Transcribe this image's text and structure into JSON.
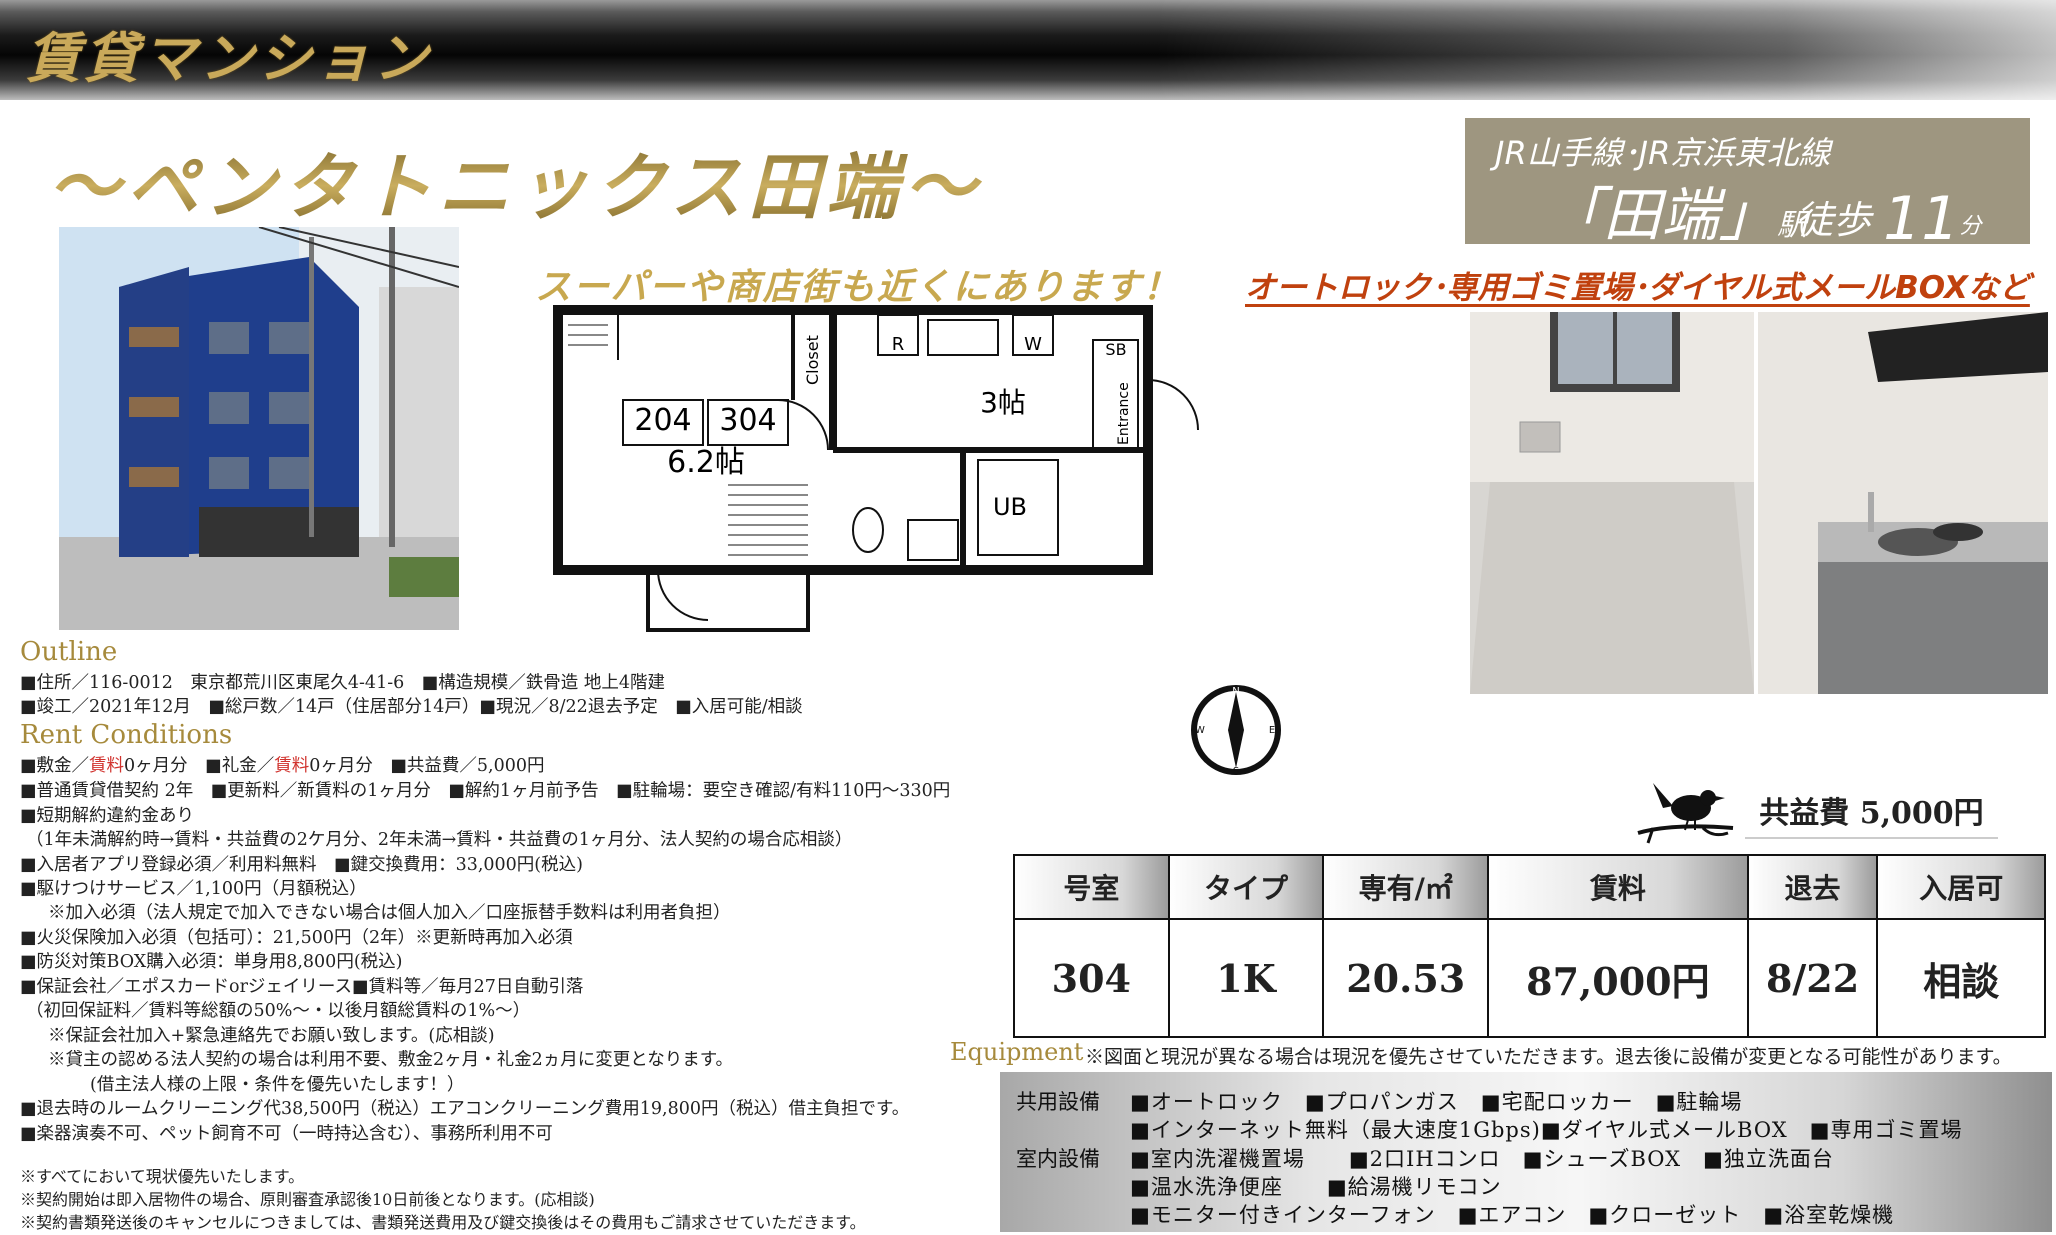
{
  "header": {
    "category": "賃貸マンション"
  },
  "property": {
    "name": "〜ペンタトニックス田端〜"
  },
  "station": {
    "lines": "JR山手線･JR京浜東北線",
    "name": "「田端」",
    "suffix": "駅",
    "walk_label": "徒歩",
    "walk_minutes": "11",
    "walk_unit": "分"
  },
  "features_highlight": "オートロック･専用ゴミ置場･ダイヤル式メールBOXなど",
  "floorplan": {
    "heading": "スーパーや商店街も近くにあります！",
    "room_numbers": [
      "204",
      "304"
    ],
    "main_room": "6.2帖",
    "kitchen": "3帖",
    "bath": "UB",
    "closet": "Closet",
    "entrance": "Entrance",
    "sb": "SB",
    "refrigerator": "R",
    "washer": "W"
  },
  "outline": {
    "label": "Outline",
    "lines": [
      "■住所／116-0012　東京都荒川区東尾久4-41-6　■構造規模／鉄骨造 地上4階建",
      "■竣工／2021年12月　■総戸数／14戸（住居部分14戸）■現況／8/22退去予定　■入居可能/相談"
    ]
  },
  "rent_conditions": {
    "label": "Rent Conditions",
    "deposit_prefix": "■敷金／",
    "deposit_red": "賃料",
    "deposit_suffix": "0ヶ月分　■礼金／",
    "key_red": "賃料",
    "key_suffix": "0ヶ月分　■共益費／5,000円",
    "lines": [
      "■普通賃貸借契約 2年　■更新料／新賃料の1ヶ月分　■解約1ヶ月前予告　■駐輪場：要空き確認/有料110円〜330円",
      "■短期解約違約金あり",
      "（1年未満解約時→賃料・共益費の2ケ月分、2年未満→賃料・共益費の1ヶ月分、法人契約の場合応相談）",
      "■入居者アプリ登録必須／利用料無料　■鍵交換費用：33,000円(税込)",
      "■駆けつけサービス／1,100円（月額税込）",
      "※加入必須（法人規定で加入できない場合は個人加入／口座振替手数料は利用者負担）",
      "■火災保険加入必須（包括可）：21,500円（2年）※更新時再加入必須",
      "■防災対策BOX購入必須：単身用8,800円(税込)",
      "■保証会社／エポスカードorジェイリース■賃料等／毎月27日自動引落",
      "（初回保証料／賃料等総額の50%〜・以後月額総賃料の1%〜）",
      "※保証会社加入+緊急連絡先でお願い致します。(応相談)",
      "※貸主の認める法人契約の場合は利用不要、敷金2ヶ月・礼金2ヵ月に変更となります。",
      "(借主法人様の上限・条件を優先いたします！）",
      "■退去時のルームクリーニング代38,500円（税込）エアコンクリーニング費用19,800円（税込）借主負担です。",
      "■楽器演奏不可、ペット飼育不可（一時持込含む）、事務所利用不可"
    ]
  },
  "notes": [
    "※すべてにおいて現状優先いたします。",
    "※契約開始は即入居物件の場合、原則審査承認後10日前後となります。(応相談)",
    "※契約書類発送後のキャンセルにつきましては、書類発送費用及び鍵交換後はその費用もご請求させていただきます。"
  ],
  "common_fee": "共益費 5,000円",
  "rent_table": {
    "headers": [
      "号室",
      "タイプ",
      "専有/㎡",
      "賃料",
      "退去",
      "入居可"
    ],
    "row": [
      "304",
      "1K",
      "20.53",
      "87,000円",
      "8/22",
      "相談"
    ]
  },
  "equipment": {
    "label": "Equipment",
    "note": "※図面と現況が異なる場合は現況を優先させていただきます。退去後に設備が変更となる可能性があります。",
    "common_label": "共用設備",
    "room_label": "室内設備",
    "rows": [
      "■オートロック　■プロパンガス　■宅配ロッカー　■駐輪場",
      "■インターネット無料（最大速度1Gbps)■ダイヤル式メールBOX　■専用ゴミ置場",
      "■室内洗濯機置場　　■2口IHコンロ　■シューズBOX　■独立洗面台",
      "■温水洗浄便座　　■給湯機リモコン",
      "■モニター付きインターフォン　■エアコン　■クローゼット　■浴室乾燥機"
    ]
  }
}
